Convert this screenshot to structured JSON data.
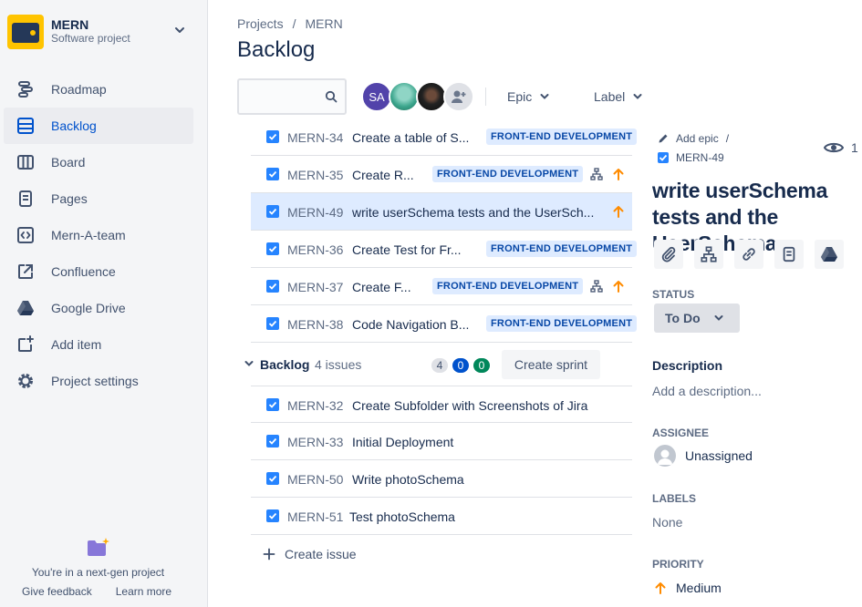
{
  "project": {
    "name": "MERN",
    "type": "Software project"
  },
  "nav": {
    "items": [
      {
        "label": "Roadmap",
        "icon": "roadmap-icon"
      },
      {
        "label": "Backlog",
        "icon": "backlog-icon",
        "active": true
      },
      {
        "label": "Board",
        "icon": "board-icon"
      },
      {
        "label": "Pages",
        "icon": "pages-icon"
      },
      {
        "label": "Mern-A-team",
        "icon": "code-icon"
      },
      {
        "label": "Confluence",
        "icon": "external-link-icon"
      },
      {
        "label": "Google Drive",
        "icon": "google-drive-icon"
      },
      {
        "label": "Add item",
        "icon": "add-item-icon"
      },
      {
        "label": "Project settings",
        "icon": "gear-icon"
      }
    ]
  },
  "footer": {
    "text": "You're in a next-gen project",
    "give_feedback": "Give feedback",
    "learn_more": "Learn more"
  },
  "breadcrumb": {
    "projects": "Projects",
    "sep": "/",
    "project": "MERN"
  },
  "page_title": "Backlog",
  "search": {
    "placeholder": ""
  },
  "avatars": {
    "first_initials": "SA"
  },
  "filters": {
    "epic": "Epic",
    "label": "Label"
  },
  "sprint_issues": [
    {
      "key": "MERN-34",
      "summary": "Create a table of S...",
      "epic": "FRONT-END DEVELOPMENT"
    },
    {
      "key": "MERN-35",
      "summary": "Create R...",
      "epic": "FRONT-END DEVELOPMENT",
      "subtasks": true,
      "priority": "up"
    },
    {
      "key": "MERN-49",
      "summary": "write userSchema tests and the UserSch...",
      "priority": "up",
      "selected": true
    },
    {
      "key": "MERN-36",
      "summary": "Create Test for Fr...",
      "epic": "FRONT-END DEVELOPMENT"
    },
    {
      "key": "MERN-37",
      "summary": "Create F...",
      "epic": "FRONT-END DEVELOPMENT",
      "subtasks": true,
      "priority": "up"
    },
    {
      "key": "MERN-38",
      "summary": "Code Navigation B...",
      "epic": "FRONT-END DEVELOPMENT"
    }
  ],
  "backlog": {
    "title": "Backlog",
    "count": "4 issues",
    "todo": "4",
    "in_progress": "0",
    "done": "0",
    "create_sprint": "Create sprint",
    "issues": [
      {
        "key": "MERN-32",
        "summary": "Create Subfolder with Screenshots of Jira"
      },
      {
        "key": "MERN-33",
        "summary": "Initial Deployment"
      },
      {
        "key": "MERN-50",
        "summary": "Write photoSchema"
      },
      {
        "key": "MERN-51",
        "summary": "Test photoSchema"
      }
    ]
  },
  "create_issue": "Create issue",
  "detail": {
    "add_epic": "Add epic",
    "sep": "/",
    "key": "MERN-49",
    "watchers": "1",
    "title": "write userSchema tests and the UserSchema",
    "status_label": "STATUS",
    "status": "To Do",
    "description_label": "Description",
    "description_placeholder": "Add a description...",
    "assignee_label": "ASSIGNEE",
    "assignee": "Unassigned",
    "labels_label": "LABELS",
    "labels": "None",
    "priority_label": "PRIORITY",
    "priority": "Medium"
  },
  "colors": {
    "accent": "#0052CC",
    "priority_up": "#FF8B00",
    "checkbox": "#2684FF",
    "lozenge_bg": "#DEEBFF"
  }
}
